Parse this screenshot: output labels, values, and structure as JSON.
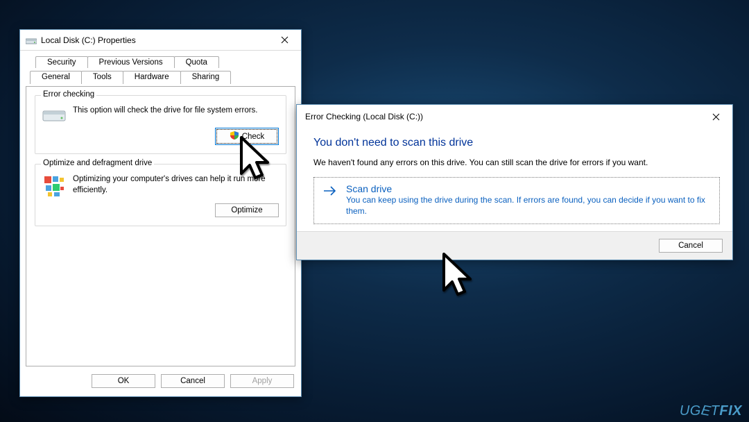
{
  "watermark": "UGETFIX",
  "props": {
    "title": "Local Disk (C:) Properties",
    "tabs_row1": [
      "Security",
      "Previous Versions",
      "Quota"
    ],
    "tabs_row2": [
      "General",
      "Tools",
      "Hardware",
      "Sharing"
    ],
    "active_tab": "Tools",
    "group_error_checking": {
      "legend": "Error checking",
      "text": "This option will check the drive for file system errors.",
      "button": "Check"
    },
    "group_optimize": {
      "legend": "Optimize and defragment drive",
      "text": "Optimizing your computer's drives can help it run more efficiently.",
      "button": "Optimize"
    },
    "buttons": {
      "ok": "OK",
      "cancel": "Cancel",
      "apply": "Apply"
    }
  },
  "err": {
    "title": "Error Checking (Local Disk (C:))",
    "heading": "You don't need to scan this drive",
    "desc": "We haven't found any errors on this drive. You can still scan the drive for errors if you want.",
    "scan_title": "Scan drive",
    "scan_sub": "You can keep using the drive during the scan. If errors are found, you can decide if you want to fix them.",
    "cancel": "Cancel"
  },
  "icons": {
    "drive": "drive-icon",
    "defrag": "defrag-icon",
    "shield": "uac-shield-icon",
    "close": "close-icon",
    "arrow": "arrow-right-icon"
  }
}
